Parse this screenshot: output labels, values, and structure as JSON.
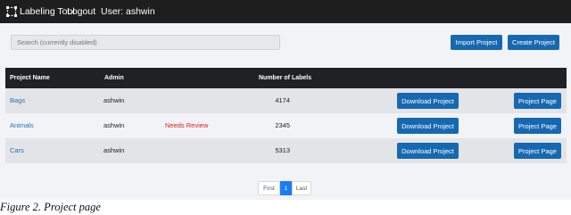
{
  "navbar": {
    "brand": "Labeling Tool",
    "brand_icon": "tag-icon",
    "logout": "Logout",
    "user": "User: ashwin"
  },
  "search": {
    "placeholder": "Search (currently disabled)"
  },
  "actions": {
    "import": "Import Project",
    "create": "Create Project"
  },
  "table": {
    "headers": {
      "name": "Project Name",
      "admin": "Admin",
      "labels": "Number of Labels"
    },
    "rows": [
      {
        "name": "Bags",
        "admin": "ashwin",
        "status": "",
        "count": "4174",
        "download": "Download Project",
        "page": "Project Page"
      },
      {
        "name": "Animals",
        "admin": "ashwin",
        "status": "Needs Review",
        "count": "2345",
        "download": "Download Project",
        "page": "Project Page"
      },
      {
        "name": "Cars",
        "admin": "ashwin",
        "status": "",
        "count": "5313",
        "download": "Download Project",
        "page": "Project Page"
      }
    ]
  },
  "pagination": {
    "first": "First",
    "current": "1",
    "last": "Last"
  },
  "caption": "Figure 2. Project page",
  "colors": {
    "navbar": "#1e1e1e",
    "primary": "#1669b0",
    "link": "#1f6fb5",
    "status_alert": "#e02020",
    "page_active": "#1a7ef0"
  }
}
